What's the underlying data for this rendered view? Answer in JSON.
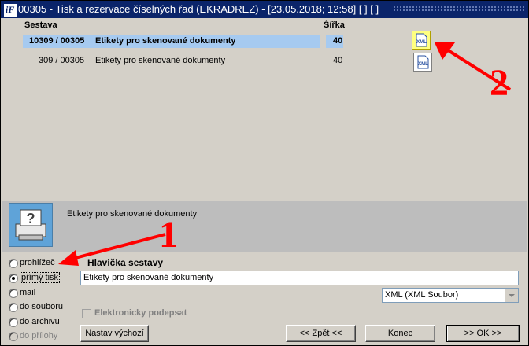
{
  "window": {
    "title": "00305 - Tisk a rezervace číselných řad (EKRADREZ) - [23.05.2018; 12:58]  [ ]  [ ]",
    "app_icon_text": "iF"
  },
  "list": {
    "columns": {
      "sestava": "Sestava",
      "sirka": "Šířka"
    },
    "rows": [
      {
        "code": "10309 / 00305",
        "name": "Etikety pro skenované dokumenty",
        "width": "40",
        "selected": true
      },
      {
        "code": "309 / 00305",
        "name": "Etikety pro skenované dokumenty",
        "width": "40",
        "selected": false
      }
    ],
    "row_icon": "xml-file-icon"
  },
  "preview": {
    "icon": "printer-help-icon",
    "description": "Etikety pro skenované dokumenty"
  },
  "output_options": [
    {
      "label": "prohlížeč",
      "checked": false,
      "disabled": false
    },
    {
      "label": "přímý tisk",
      "checked": true,
      "disabled": false
    },
    {
      "label": "mail",
      "checked": false,
      "disabled": false
    },
    {
      "label": "do souboru",
      "checked": false,
      "disabled": false
    },
    {
      "label": "do archivu",
      "checked": false,
      "disabled": false
    },
    {
      "label": "do přílohy",
      "checked": false,
      "disabled": true
    }
  ],
  "header_section": {
    "label": "Hlavička sestavy",
    "value": "Etikety pro skenované dokumenty"
  },
  "format_select": {
    "value": "XML (XML Soubor)"
  },
  "sign_checkbox": {
    "label": "Elektronicky podepsat",
    "checked": false,
    "disabled": true
  },
  "buttons": {
    "defaults": "Nastav výchozí",
    "back": "<< Zpět <<",
    "end": "Konec",
    "ok": ">> OK >>"
  },
  "annotations": {
    "one": "1",
    "two": "2"
  },
  "colors": {
    "selection": "#a6caf0",
    "titlebar": "#0a246a",
    "annotation": "#ff0000"
  }
}
